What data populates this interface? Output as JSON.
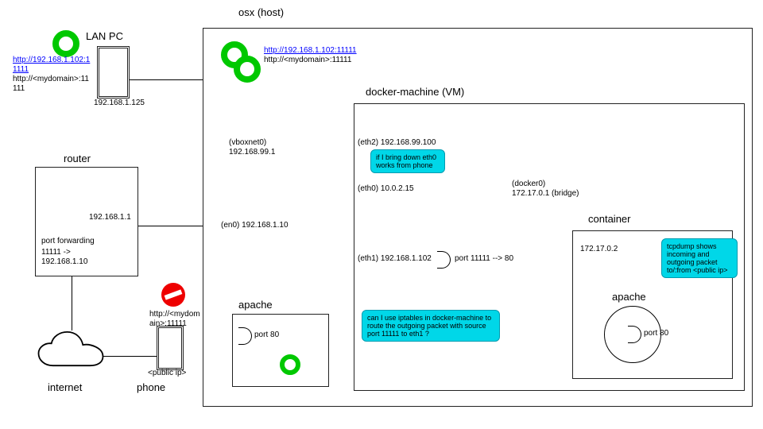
{
  "lan_pc": {
    "title": "LAN PC",
    "ip": "192.168.1.125",
    "link1": "http://192.168.1.102:11111",
    "link2": "http://<mydomain>:11111"
  },
  "router": {
    "title": "router",
    "ip": "192.168.1.1",
    "forward_title": "port forwarding",
    "forward_rule": "11111 -> 192.168.1.10"
  },
  "internet": {
    "title": "internet"
  },
  "phone": {
    "title": "phone",
    "ip": "<public ip>",
    "link": "http://<mydomain>:11111"
  },
  "osx": {
    "title": "osx (host)",
    "link1": "http://192.168.1.102:11111",
    "link2": "http://<mydomain>:11111",
    "vboxnet": "(vboxnet0) 192.168.99.1",
    "en0": "(en0) 192.168.1.10"
  },
  "apache_host": {
    "title": "apache",
    "port": "port 80"
  },
  "vm": {
    "title": "docker-machine (VM)",
    "eth2": "(eth2) 192.168.99.100",
    "eth0": "(eth0) 10.0.2.15",
    "eth1": "(eth1) 192.168.1.102",
    "docker0": "(docker0) 172.17.0.1 (bridge)",
    "portmap": "port 11111 --> 80",
    "note_eth0": "if I bring down eth0 works from phone",
    "note_iptables": "can I use iptables in docker-machine to route the outgoing packet with source port 11111 to eth1 ?"
  },
  "container": {
    "title": "container",
    "ip": "172.17.0.2",
    "note": "tcpdump shows incoming and outgoing packet to/:from <public ip>",
    "apache": {
      "title": "apache",
      "port": "port 80"
    }
  }
}
